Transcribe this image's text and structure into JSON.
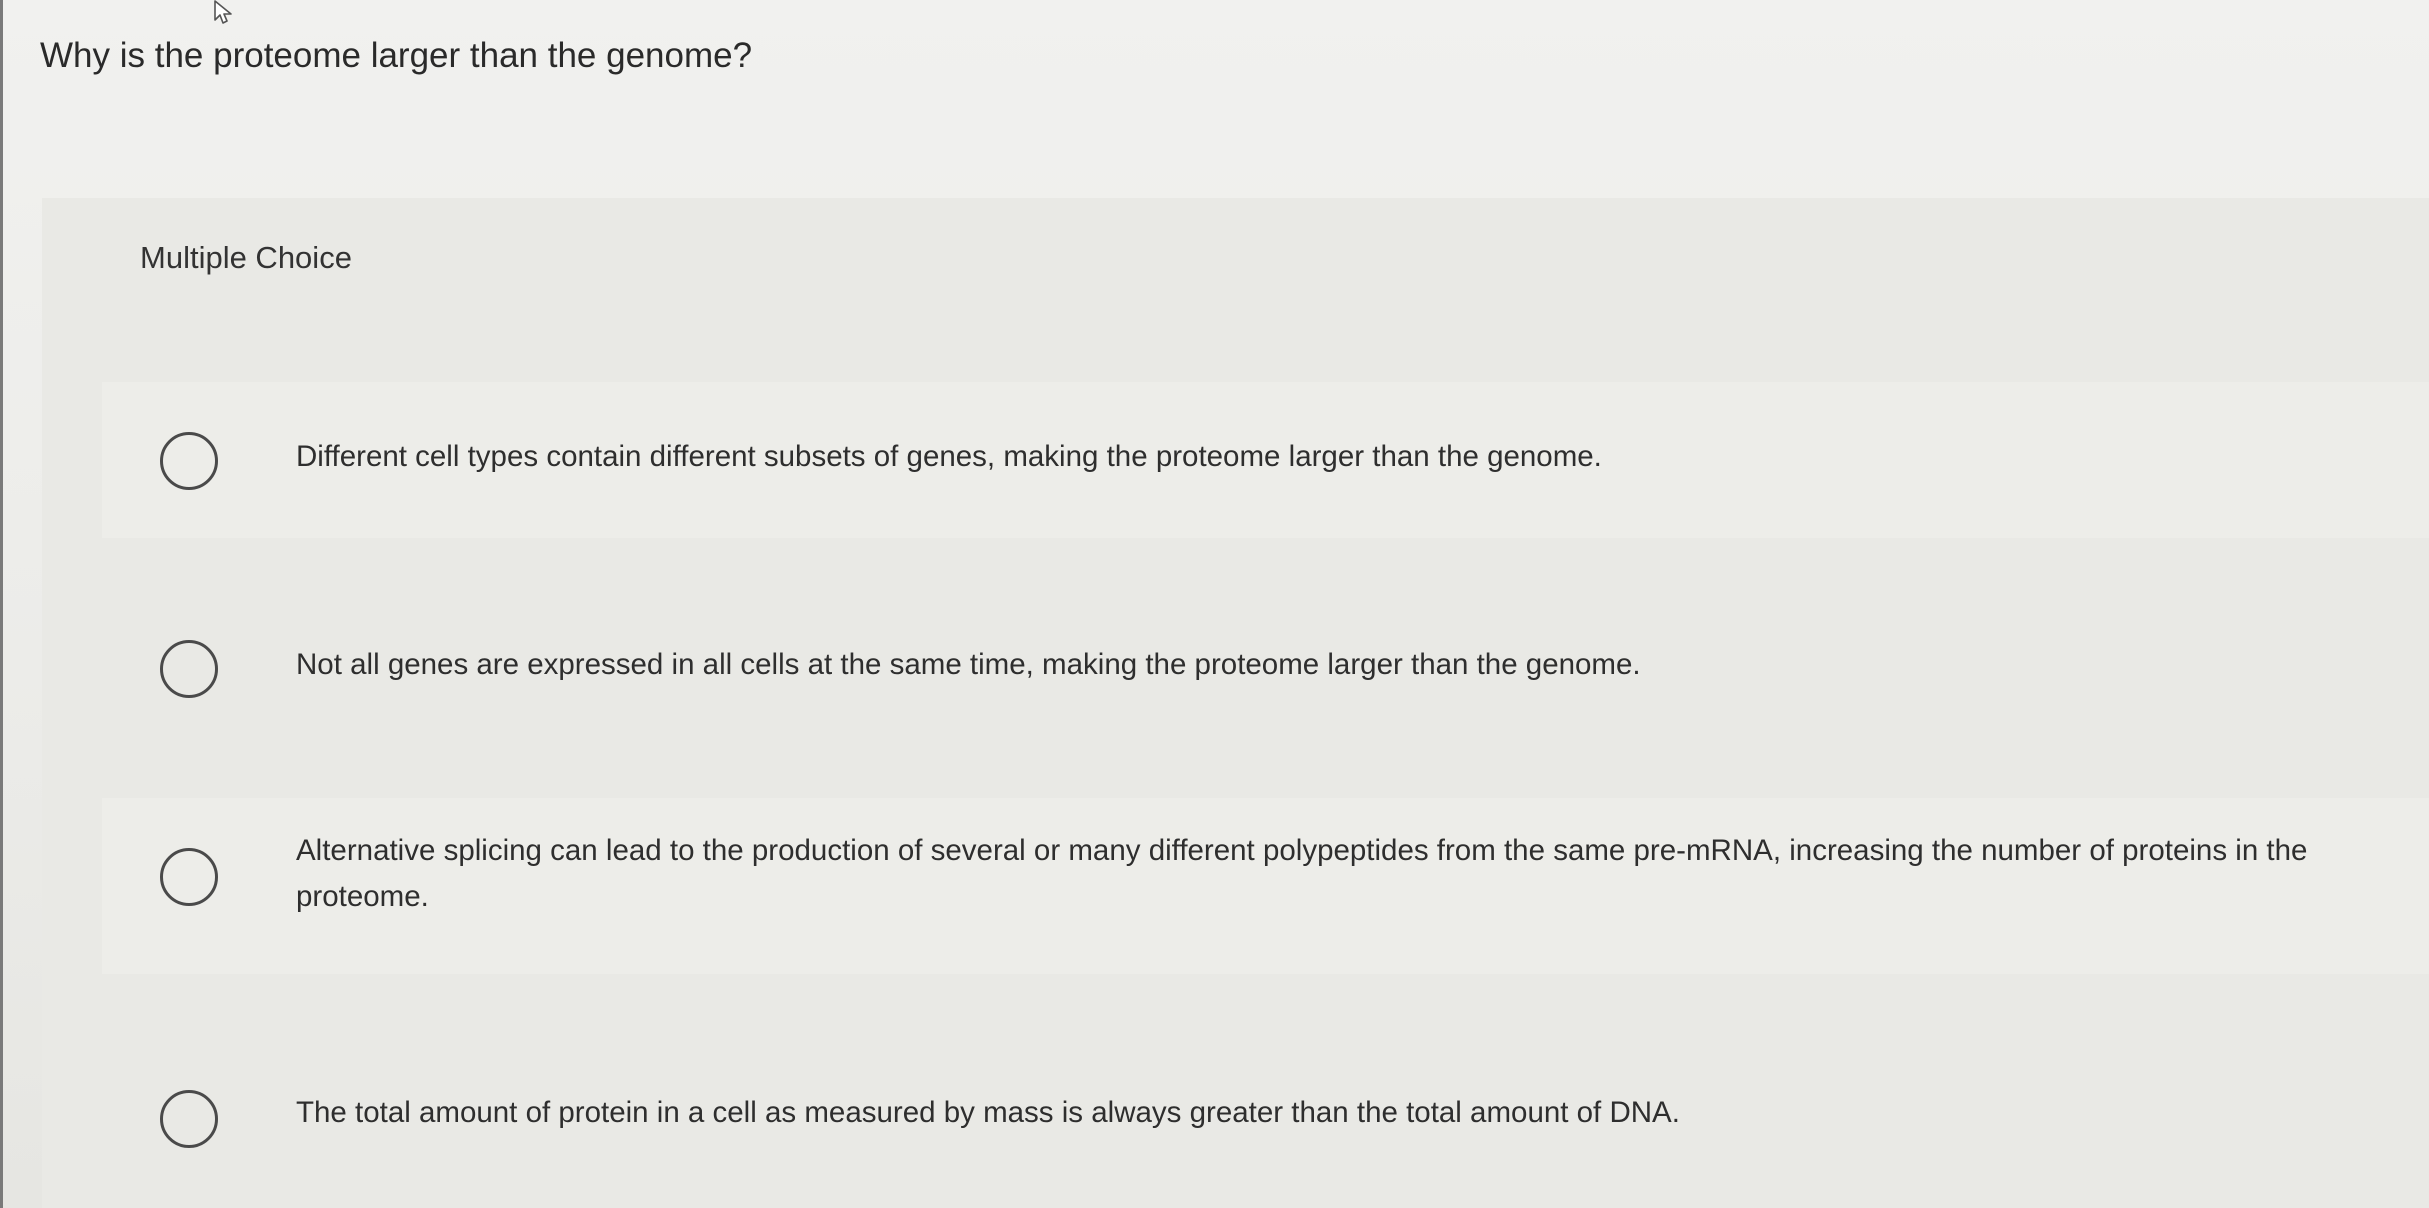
{
  "question": {
    "text": "Why is the proteome larger than the genome?"
  },
  "section": {
    "label": "Multiple Choice"
  },
  "options": [
    {
      "text": "Different cell types contain different subsets of genes, making the proteome larger than the genome."
    },
    {
      "text": "Not all genes are expressed in all cells at the same time, making the proteome larger than the genome."
    },
    {
      "text": "Alternative splicing can lead to the production of several or many different polypeptides from the same pre-mRNA, increasing the number of proteins in the proteome."
    },
    {
      "text": "The total amount of protein in a cell as measured by mass is always greater than the total amount of DNA."
    }
  ],
  "icons": {
    "cursor": "mouse-pointer-icon"
  }
}
